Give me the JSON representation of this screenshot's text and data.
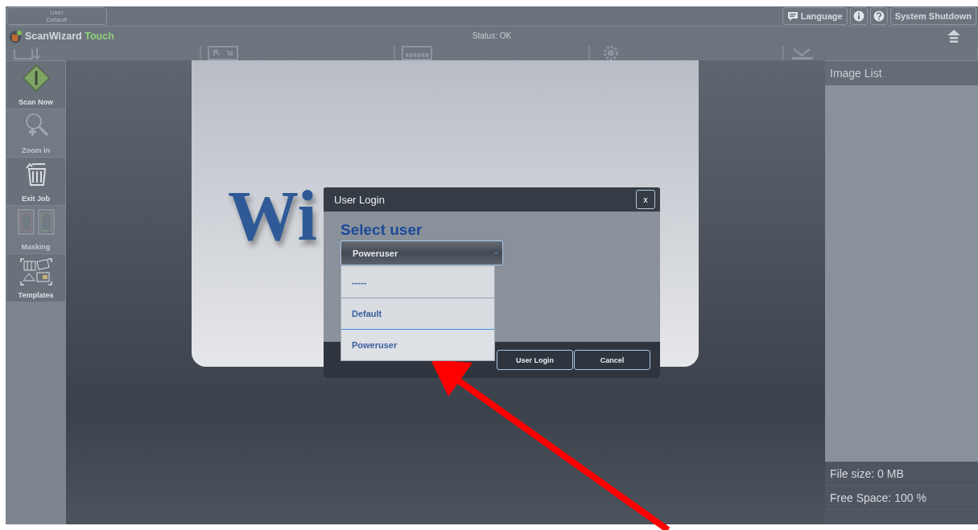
{
  "top_bar": {
    "user_button": {
      "label": "User",
      "value": "Default"
    },
    "buttons": [
      {
        "kind": "language",
        "label": "Language"
      },
      {
        "kind": "info"
      },
      {
        "kind": "help"
      },
      {
        "kind": "text",
        "label": "System Shutdown"
      }
    ]
  },
  "header": {
    "app_name": "ScanWizard",
    "app_suffix": "Touch",
    "status": "Status: OK",
    "tabs": [
      {
        "kind": "format"
      },
      {
        "kind": "size"
      },
      {
        "kind": "quality"
      },
      {
        "kind": "enhancement"
      },
      {
        "kind": "transfer"
      }
    ]
  },
  "sidebar": {
    "items": [
      {
        "kind": "scan",
        "label": "Scan Now",
        "disabled": false
      },
      {
        "kind": "zoom",
        "label": "Zoom in",
        "disabled": true
      },
      {
        "kind": "trash",
        "label": "Exit Job",
        "disabled": false
      },
      {
        "kind": "masking",
        "label": "Masking",
        "disabled": true
      },
      {
        "kind": "templates",
        "label": "Templates",
        "disabled": false
      }
    ]
  },
  "splash": {
    "wordmark": "Wi"
  },
  "image_list": {
    "title": "Image List",
    "file_size": "File size: 0 MB",
    "free_space": "Free Space: 100 %"
  },
  "dialog": {
    "title": "User Login",
    "close": "x",
    "heading": "Select user",
    "select": {
      "value": "Poweruser",
      "expanded": true,
      "options": [
        {
          "label": "-----",
          "selected": false
        },
        {
          "label": "Default",
          "selected": false
        },
        {
          "label": "Poweruser",
          "selected": true
        }
      ]
    },
    "buttons": [
      "User Login",
      "Cancel"
    ]
  }
}
